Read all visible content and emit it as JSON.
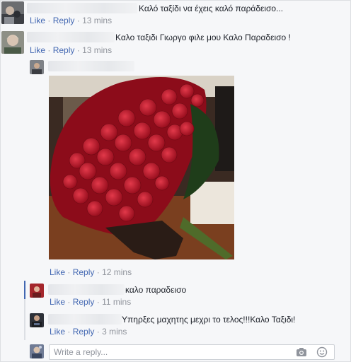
{
  "comments": [
    {
      "text": "Καλό ταξίδι να έχεις καλό παράδεισο...",
      "like": "Like",
      "reply": "Reply",
      "sep": "·",
      "time": "13 mins"
    },
    {
      "text": "Καλο ταξιδι Γιωργο φιλε μου Καλο Παραδεισο !",
      "like": "Like",
      "reply": "Reply",
      "sep": "·",
      "time": "13 mins"
    }
  ],
  "photo_comment": {
    "like": "Like",
    "reply": "Reply",
    "sep": "·",
    "time": "12 mins",
    "image_subject": "bouquet of red roses"
  },
  "replies": [
    {
      "text": "καλο παραδεισο",
      "like": "Like",
      "reply": "Reply",
      "sep": "·",
      "time": "11 mins"
    },
    {
      "text": "Υπηρξες μαχητης μεχρι το τελος!!!Καλο Ταξιδι!",
      "like": "Like",
      "reply": "Reply",
      "sep": "·",
      "time": "3 mins"
    }
  ],
  "reply_box": {
    "placeholder": "Write a reply...",
    "icons": [
      "camera-icon",
      "emoji-icon"
    ]
  },
  "colors": {
    "link": "#4267b2",
    "meta": "#90949c",
    "text": "#1d2129",
    "background": "#f6f7f9"
  }
}
